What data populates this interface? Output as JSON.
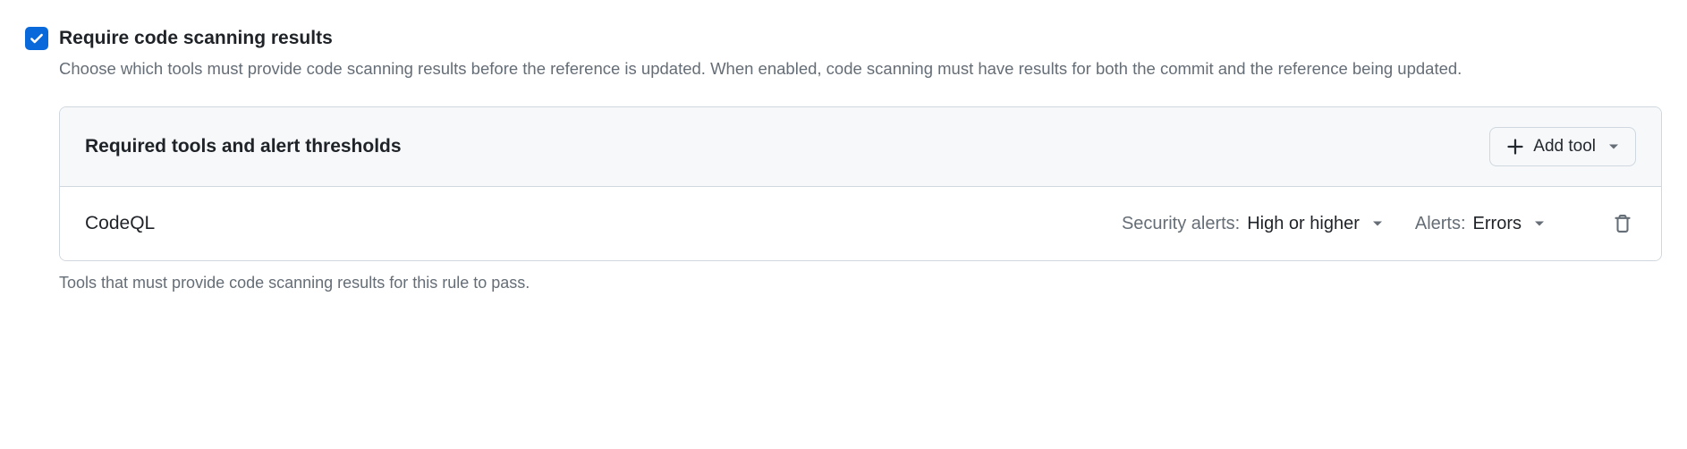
{
  "setting": {
    "title": "Require code scanning results",
    "description": "Choose which tools must provide code scanning results before the reference is updated. When enabled, code scanning must have results for both the commit and the reference being updated."
  },
  "panel": {
    "title": "Required tools and alert thresholds",
    "add_button_label": "Add tool"
  },
  "tools": [
    {
      "name": "CodeQL",
      "security_alerts_label": "Security alerts:",
      "security_alerts_value": "High or higher",
      "alerts_label": "Alerts:",
      "alerts_value": "Errors"
    }
  ],
  "footer_text": "Tools that must provide code scanning results for this rule to pass."
}
